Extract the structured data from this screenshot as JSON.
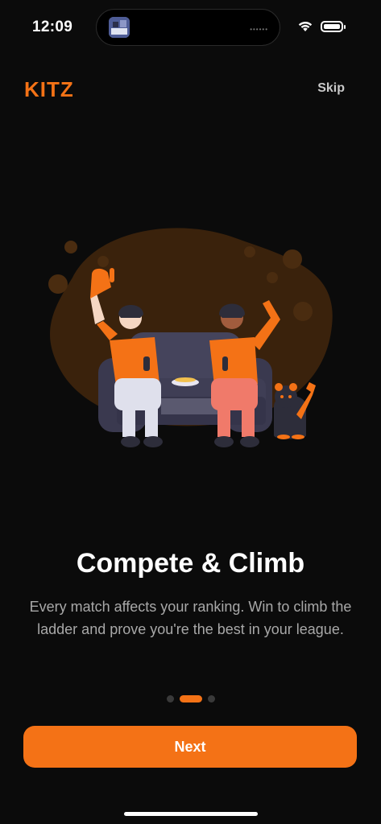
{
  "status_bar": {
    "time": "12:09"
  },
  "header": {
    "brand": "KITZ",
    "skip_label": "Skip"
  },
  "onboarding": {
    "title": "Compete & Climb",
    "description": "Every match affects your ranking. Win to climb the ladder and prove you're the best in your league.",
    "page_indicator": {
      "total": 3,
      "active": 2
    },
    "next_label": "Next"
  },
  "colors": {
    "accent": "#f47216",
    "background": "#0b0b0b"
  }
}
